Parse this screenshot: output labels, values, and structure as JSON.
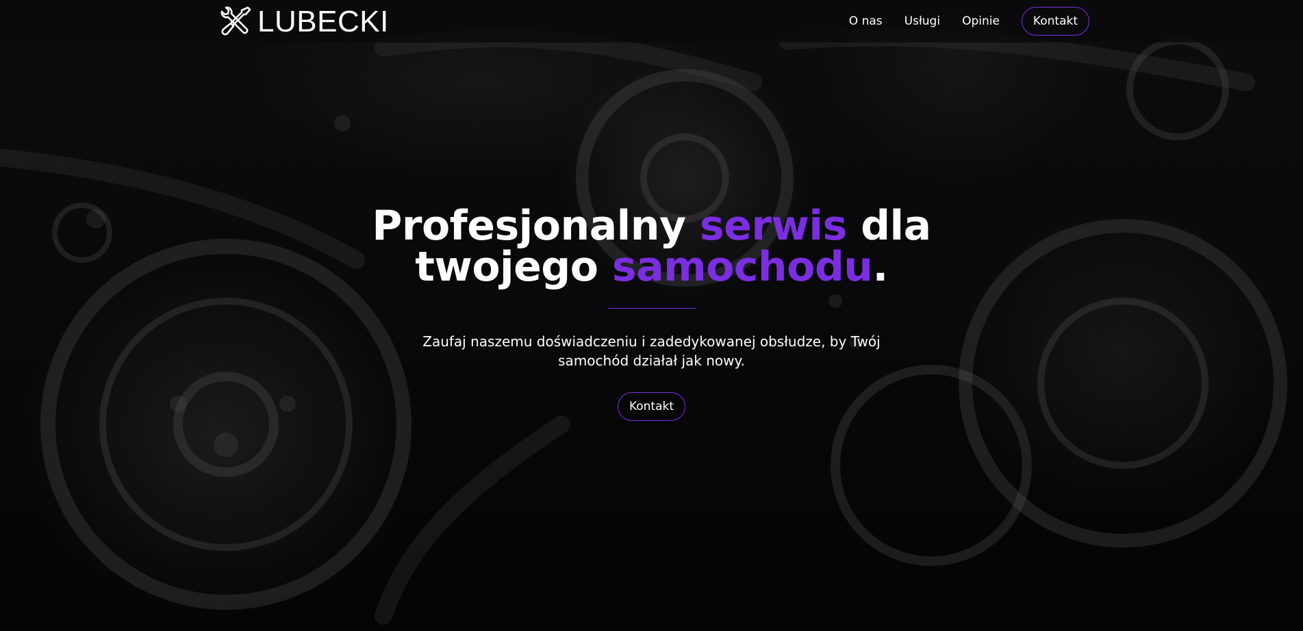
{
  "brand": {
    "name": "LUBECKI",
    "icon": "wrench-screwdriver-icon"
  },
  "nav": {
    "items": [
      {
        "label": "O nas"
      },
      {
        "label": "Usługi"
      },
      {
        "label": "Opinie"
      }
    ],
    "cta_label": "Kontakt"
  },
  "hero": {
    "title_line1_part1": "Profesjonalny ",
    "title_line1_accent": "serwis",
    "title_line1_part2": " dla",
    "title_line2_part1": "twojego ",
    "title_line2_accent": "samochodu",
    "title_line2_part2": ".",
    "subtitle": "Zaufaj naszemu doświadczeniu i zadedykowanej obsłudze, by Twój samochód działał jak nowy.",
    "cta_label": "Kontakt"
  },
  "colors": {
    "accent": "#7a2ee0",
    "background": "#0b0b0d",
    "text": "#ffffff"
  }
}
